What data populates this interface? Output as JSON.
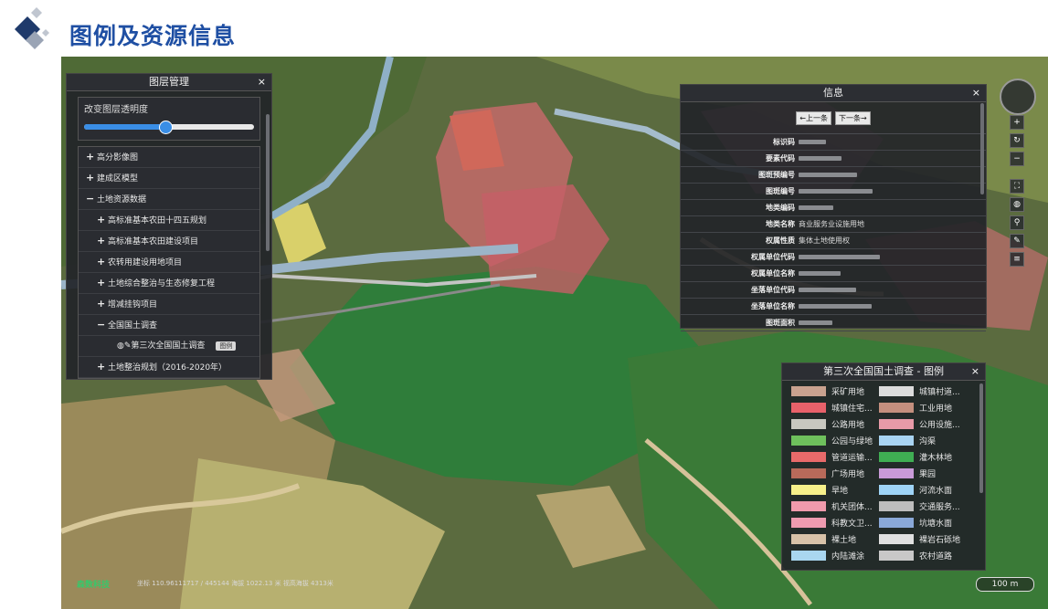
{
  "page": {
    "title": "图例及资源信息"
  },
  "layer_panel": {
    "title": "图层管理",
    "close": "×",
    "opacity_label": "改变图层透明度",
    "opacity_value": 0.48,
    "items": [
      {
        "sign": "+",
        "label": "高分影像图"
      },
      {
        "sign": "+",
        "label": "建成区模型"
      },
      {
        "sign": "−",
        "label": "土地资源数据"
      },
      {
        "sign": "+",
        "label": "高标准基本农田十四五规划"
      },
      {
        "sign": "+",
        "label": "高标准基本农田建设项目"
      },
      {
        "sign": "+",
        "label": "农转用建设用地项目"
      },
      {
        "sign": "+",
        "label": "土地综合整治与生态修复工程"
      },
      {
        "sign": "+",
        "label": "增减挂钩项目"
      },
      {
        "sign": "−",
        "label": "全国国土调查"
      },
      {
        "sign": "",
        "label": "第三次全国国土调查",
        "tag": "图例"
      },
      {
        "sign": "+",
        "label": "土地整治规划（2016-2020年）"
      }
    ]
  },
  "info_panel": {
    "title": "信息",
    "close": "×",
    "prev": "←上一条",
    "next": "下一条→",
    "rows": [
      {
        "key": "标识码",
        "value": ""
      },
      {
        "key": "要素代码",
        "value": ""
      },
      {
        "key": "图斑预编号",
        "value": ""
      },
      {
        "key": "图斑编号",
        "value": ""
      },
      {
        "key": "地类编码",
        "value": ""
      },
      {
        "key": "地类名称",
        "value": "商业服务业设施用地"
      },
      {
        "key": "权属性质",
        "value": "集体土地使用权"
      },
      {
        "key": "权属单位代码",
        "value": ""
      },
      {
        "key": "权属单位名称",
        "value": ""
      },
      {
        "key": "坐落单位代码",
        "value": ""
      },
      {
        "key": "坐落单位名称",
        "value": ""
      },
      {
        "key": "图斑面积",
        "value": ""
      }
    ]
  },
  "legend_panel": {
    "title": "第三次全国国土调查 - 图例",
    "close": "×",
    "items": [
      {
        "label": "采矿用地",
        "color": "#c9a28f"
      },
      {
        "label": "城镇村道...",
        "color": "#dcdcdc"
      },
      {
        "label": "城镇住宅...",
        "color": "#e8616a"
      },
      {
        "label": "工业用地",
        "color": "#c48f7e"
      },
      {
        "label": "公路用地",
        "color": "#c8c8c0"
      },
      {
        "label": "公用设施...",
        "color": "#e89aa8"
      },
      {
        "label": "公园与绿地",
        "color": "#6ec05c"
      },
      {
        "label": "沟渠",
        "color": "#a9d4f2"
      },
      {
        "label": "管道运输...",
        "color": "#e86a6a"
      },
      {
        "label": "灌木林地",
        "color": "#3fae53"
      },
      {
        "label": "广场用地",
        "color": "#b86a5a"
      },
      {
        "label": "果园",
        "color": "#c99ad8"
      },
      {
        "label": "旱地",
        "color": "#f7f08a"
      },
      {
        "label": "河流水面",
        "color": "#9fd4f7"
      },
      {
        "label": "机关团体...",
        "color": "#f09aac"
      },
      {
        "label": "交通服务...",
        "color": "#bdbdbd"
      },
      {
        "label": "科教文卫...",
        "color": "#ef9bb0"
      },
      {
        "label": "坑塘水面",
        "color": "#8aa8d8"
      },
      {
        "label": "裸土地",
        "color": "#d8c2a8"
      },
      {
        "label": "裸岩石砾地",
        "color": "#e0e0e0"
      },
      {
        "label": "内陆滩涂",
        "color": "#a9d6f0"
      },
      {
        "label": "农村道路",
        "color": "#c8c8c8"
      }
    ]
  },
  "map": {
    "brand": "森数科技",
    "status": "坐标 110.96111717 / 445144 海拔 1022.13 米 视高海拔 4313米",
    "scale": "100 m"
  }
}
